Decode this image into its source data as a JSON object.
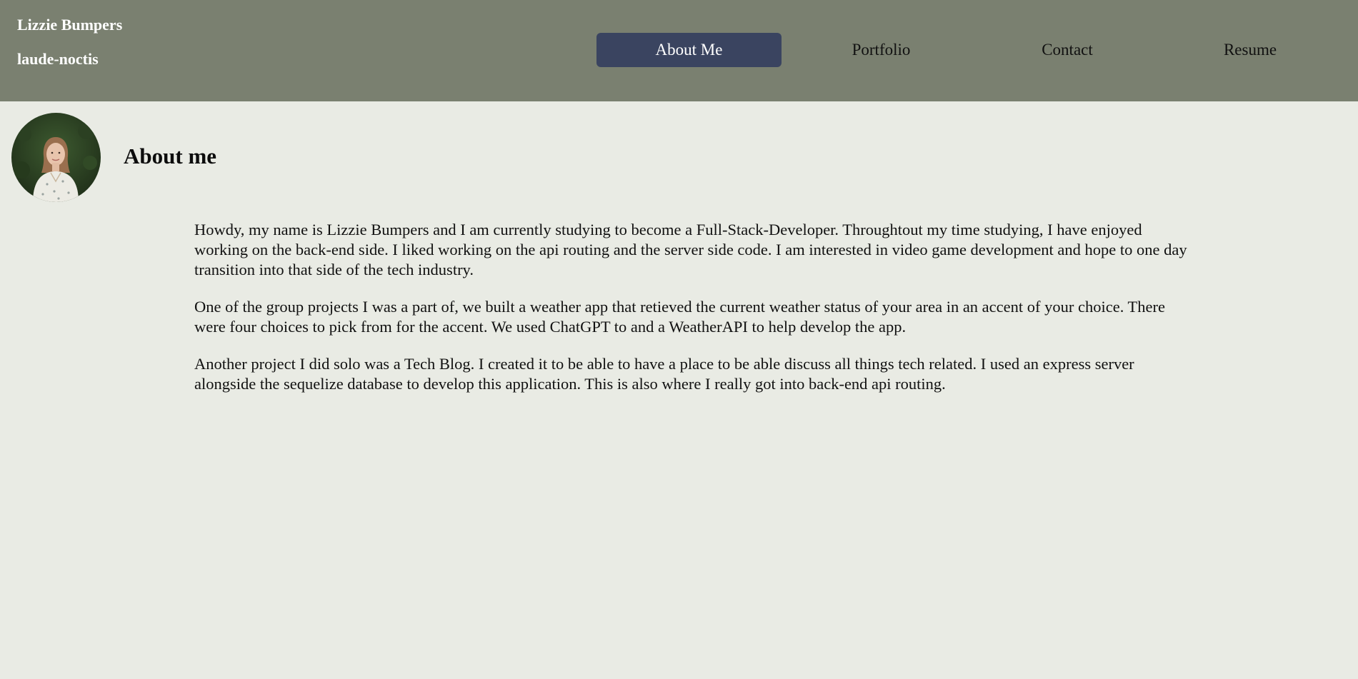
{
  "brand": {
    "name": "Lizzie Bumpers",
    "handle": "laude-noctis"
  },
  "nav": {
    "items": [
      {
        "label": "About Me",
        "active": true
      },
      {
        "label": "Portfolio",
        "active": false
      },
      {
        "label": "Contact",
        "active": false
      },
      {
        "label": "Resume",
        "active": false
      }
    ]
  },
  "avatar": {
    "icon": "profile-photo"
  },
  "about": {
    "title": "About me",
    "paragraphs": [
      "Howdy, my name is Lizzie Bumpers and I am currently studying to become a Full-Stack-Developer. Throughtout my time studying, I have enjoyed working on the back-end side. I liked working on the api routing and the server side code. I am interested in video game development and hope to one day transition into that side of the tech industry.",
      "One of the group projects I was a part of, we built a weather app that retieved the current weather status of your area in an accent of your choice. There were four choices to pick from for the accent. We used ChatGPT to and a WeatherAPI to help develop the app.",
      "Another project I did solo was a Tech Blog. I created it to be able to have a place to be able discuss all things tech related. I used an express server alongside the sequelize database to develop this application. This is also where I really got into back-end api routing."
    ]
  },
  "colors": {
    "header_bg": "#7a8070",
    "page_bg": "#e9ebe4",
    "active_nav_bg": "#3a4460"
  }
}
